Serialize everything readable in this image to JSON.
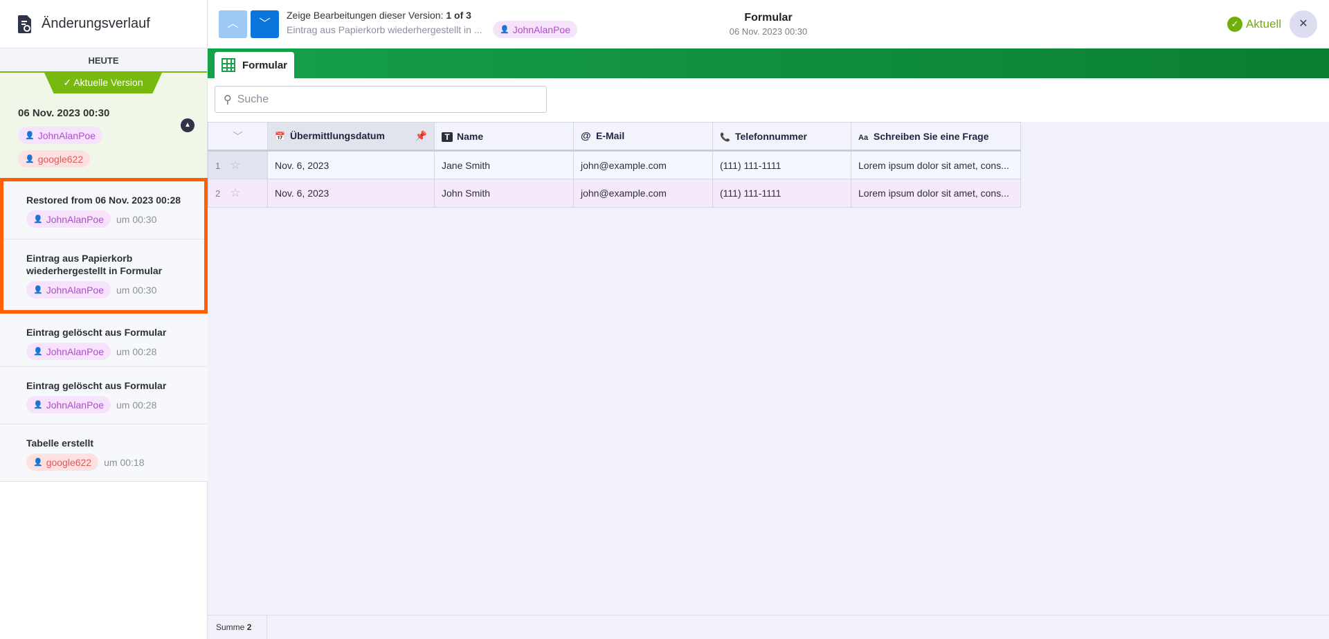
{
  "sidebar": {
    "title": "Änderungsverlauf",
    "section": "HEUTE",
    "current_badge": "Aktuelle Version",
    "current": {
      "date": "06 Nov. 2023 00:30",
      "users": [
        "JohnAlanPoe",
        "google622"
      ]
    },
    "items": [
      {
        "title": "Restored from 06 Nov. 2023 00:28",
        "user": "JohnAlanPoe",
        "time": "um 00:30"
      },
      {
        "title": "Eintrag aus Papierkorb wiederhergestellt in Formular",
        "user": "JohnAlanPoe",
        "time": "um 00:30"
      },
      {
        "title": "Eintrag gelöscht aus Formular",
        "user": "JohnAlanPoe",
        "time": "um 00:28"
      },
      {
        "title": "Eintrag gelöscht aus Formular",
        "user": "JohnAlanPoe",
        "time": "um 00:28"
      },
      {
        "title": "Tabelle erstellt",
        "user": "google622",
        "time": "um 00:18"
      }
    ]
  },
  "header": {
    "version_label": "Zeige Bearbeitungen dieser Version:",
    "version_count": "1 of 3",
    "edit_summary": "Eintrag aus Papierkorb wiederhergestellt in ...",
    "user": "JohnAlanPoe",
    "title": "Formular",
    "date": "06 Nov. 2023 00:30",
    "status": "Aktuell"
  },
  "tab": "Formular",
  "search": {
    "placeholder": "Suche"
  },
  "table": {
    "columns": [
      "Übermittlungsdatum",
      "Name",
      "E-Mail",
      "Telefonnummer",
      "Schreiben Sie eine Frage"
    ],
    "rows": [
      {
        "n": "1",
        "cells": [
          "Nov. 6, 2023",
          "Jane Smith",
          "john@example.com",
          "(111) 111-1111",
          "Lorem ipsum dolor sit amet, cons..."
        ]
      },
      {
        "n": "2",
        "cells": [
          "Nov. 6, 2023",
          "John Smith",
          "john@example.com",
          "(111) 111-1111",
          "Lorem ipsum dolor sit amet, cons..."
        ]
      }
    ]
  },
  "footer": {
    "sum_label": "Summe",
    "sum_value": "2"
  },
  "colors": {
    "accent": "#0a76dc",
    "green": "#16a04a",
    "current": "#78b90f",
    "highlight": "#ff6100"
  }
}
